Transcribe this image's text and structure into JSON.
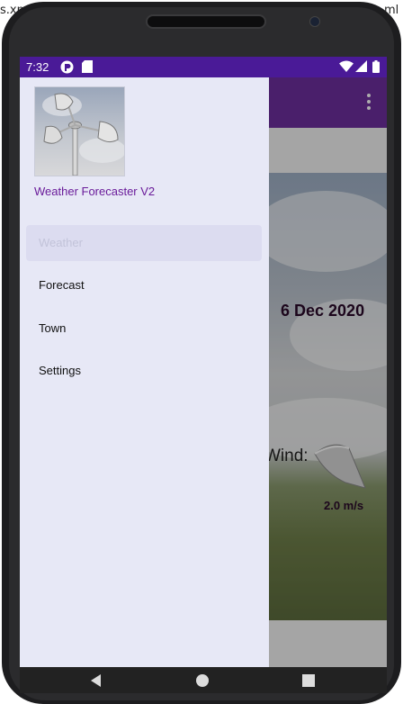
{
  "window_bg_text": {
    "left": "s.xm",
    "right": "ml"
  },
  "status_bar": {
    "time": "7:32",
    "icons": [
      "notification-icon",
      "sd-card-icon",
      "wifi-icon",
      "signal-icon",
      "battery-icon"
    ],
    "color": "#4a1a97"
  },
  "background_app": {
    "date": "6 Dec 2020",
    "wind_label": "Wind:",
    "wind_value": "2.0 m/s",
    "toolbar_color": "#6e2f9e"
  },
  "drawer": {
    "header_title": "Weather Forecaster V2",
    "items": [
      {
        "label": "Weather",
        "active": true
      },
      {
        "label": "Forecast",
        "active": false
      },
      {
        "label": "Town",
        "active": false
      },
      {
        "label": "Settings",
        "active": false
      }
    ]
  },
  "nav_bar": {
    "buttons": [
      "back-icon",
      "home-icon",
      "recents-icon"
    ]
  }
}
